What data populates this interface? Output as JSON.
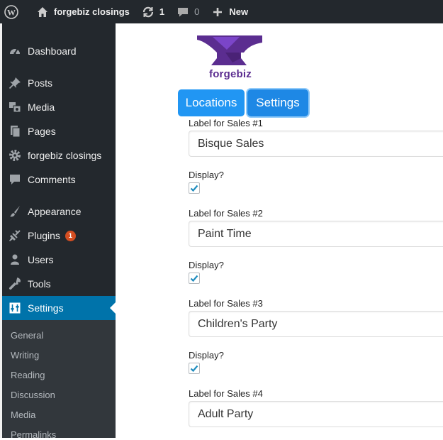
{
  "adminbar": {
    "site_name": "forgebiz closings",
    "updates_count": "1",
    "comments_count": "0",
    "new_label": "New"
  },
  "sidebar": {
    "items": [
      {
        "label": "Dashboard",
        "icon": "dashboard-icon"
      },
      {
        "label": "Posts",
        "icon": "pin-icon"
      },
      {
        "label": "Media",
        "icon": "media-icon"
      },
      {
        "label": "Pages",
        "icon": "pages-icon"
      },
      {
        "label": "forgebiz closings",
        "icon": "gear-icon"
      },
      {
        "label": "Comments",
        "icon": "comment-icon"
      },
      {
        "label": "Appearance",
        "icon": "brush-icon"
      },
      {
        "label": "Plugins",
        "icon": "plug-icon",
        "badge": "1"
      },
      {
        "label": "Users",
        "icon": "user-icon"
      },
      {
        "label": "Tools",
        "icon": "wrench-icon"
      },
      {
        "label": "Settings",
        "icon": "settings-icon",
        "active": true
      }
    ],
    "submenu": [
      "General",
      "Writing",
      "Reading",
      "Discussion",
      "Media",
      "Permalinks"
    ]
  },
  "brand": {
    "logo_text": "forgebiz"
  },
  "tabs": {
    "locations": "Locations",
    "settings": "Settings"
  },
  "fields": [
    {
      "label": "Label for Sales #1",
      "value": "Bisque Sales",
      "display_label": "Display?",
      "display_checked": true
    },
    {
      "label": "Label for Sales #2",
      "value": "Paint Time",
      "display_label": "Display?",
      "display_checked": true
    },
    {
      "label": "Label for Sales #3",
      "value": "Children's Party",
      "display_label": "Display?",
      "display_checked": true
    },
    {
      "label": "Label for Sales #4",
      "value": "Adult Party"
    }
  ],
  "colors": {
    "accent": "#0073aa",
    "tab_blue": "#2196f3",
    "brand_purple": "#5b2d90"
  }
}
